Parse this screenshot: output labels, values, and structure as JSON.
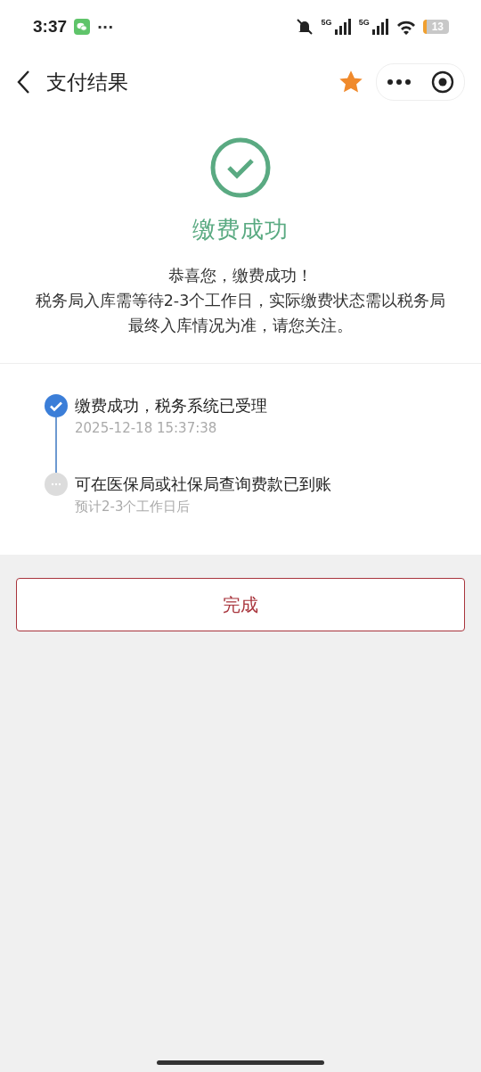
{
  "status_bar": {
    "time": "3:37",
    "more": "···",
    "network_1": "5G",
    "network_2": "5G",
    "battery": "13"
  },
  "nav": {
    "title": "支付结果",
    "favorited": true
  },
  "result": {
    "title": "缴费成功",
    "message": [
      "恭喜您，缴费成功！",
      "税务局入库需等待2-3个工作日，实际缴费状态需以税务局最终入库情况为准，请您关注。"
    ]
  },
  "steps": [
    {
      "title": "缴费成功，税务系统已受理",
      "detail": "2025-12-18 15:37:38",
      "done": true
    },
    {
      "title": "可在医保局或社保局查询费款已到账",
      "detail": "预计2-3个工作日后",
      "done": false
    }
  ],
  "button": "完成"
}
